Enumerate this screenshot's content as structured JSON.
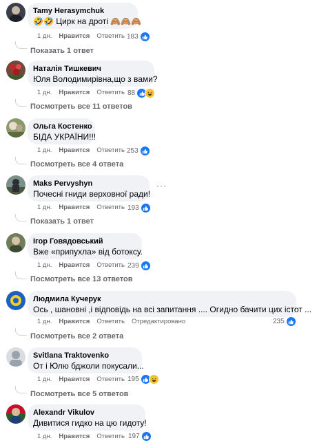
{
  "ui": {
    "like_label": "Нравится",
    "reply_label": "Ответить",
    "like_icon": "thumbs-up-icon",
    "haha_icon": "laughing-face-icon",
    "like_color": "#1877f2",
    "secondary_text_color": "#65676b",
    "bubble_color": "#f0f2f5"
  },
  "comments": [
    {
      "author": "Tamy Herasymchuk",
      "text": "🤣🤣 Цирк на дроті 🙈🙈🙈",
      "age": "1 дн.",
      "reactions": "183",
      "replies": "Показать 1 ответ",
      "edited": ""
    },
    {
      "author": "Наталія Тишкевич",
      "text": "Юля Володимирівна,що з вами?",
      "age": "1 дн.",
      "reactions": "88",
      "replies": "Посмотреть все 11 ответов",
      "edited": ""
    },
    {
      "author": "Ольга Костенко",
      "text": "БІДА УКРАЇНИ!!!",
      "age": "1 дн.",
      "reactions": "253",
      "replies": "Посмотреть все 4 ответа",
      "edited": ""
    },
    {
      "author": "Maks Pervyshyn",
      "text": "Почесні гниди верховної ради!",
      "age": "1 дн.",
      "reactions": "193",
      "replies": "Показать 1 ответ",
      "edited": "",
      "menu": "···"
    },
    {
      "author": "Ігор Говядовський",
      "text": "Вже «припухла» від ботоксу.",
      "age": "1 дн.",
      "reactions": "239",
      "replies": "Посмотреть все 13 ответов",
      "edited": ""
    },
    {
      "author": "Людмила Кучерук",
      "text": "Ось , шановні ,і відповідь на всі запитання .... Огидно бачити цих істот ...",
      "age": "1 дн.",
      "reactions": "235",
      "replies": "Посмотреть все 2 ответа",
      "edited": "Отредактировано"
    },
    {
      "author": "Svitlana Traktovenko",
      "text": "От і Юлю бджоли покусали...",
      "age": "1 дн.",
      "reactions": "195",
      "replies": "Посмотреть все 5 ответов",
      "edited": ""
    },
    {
      "author": "Alexandr Vikulov",
      "text": "Дивитися гидко на цю гидоту!",
      "age": "1 дн.",
      "reactions": "197",
      "replies": "",
      "edited": ""
    }
  ]
}
